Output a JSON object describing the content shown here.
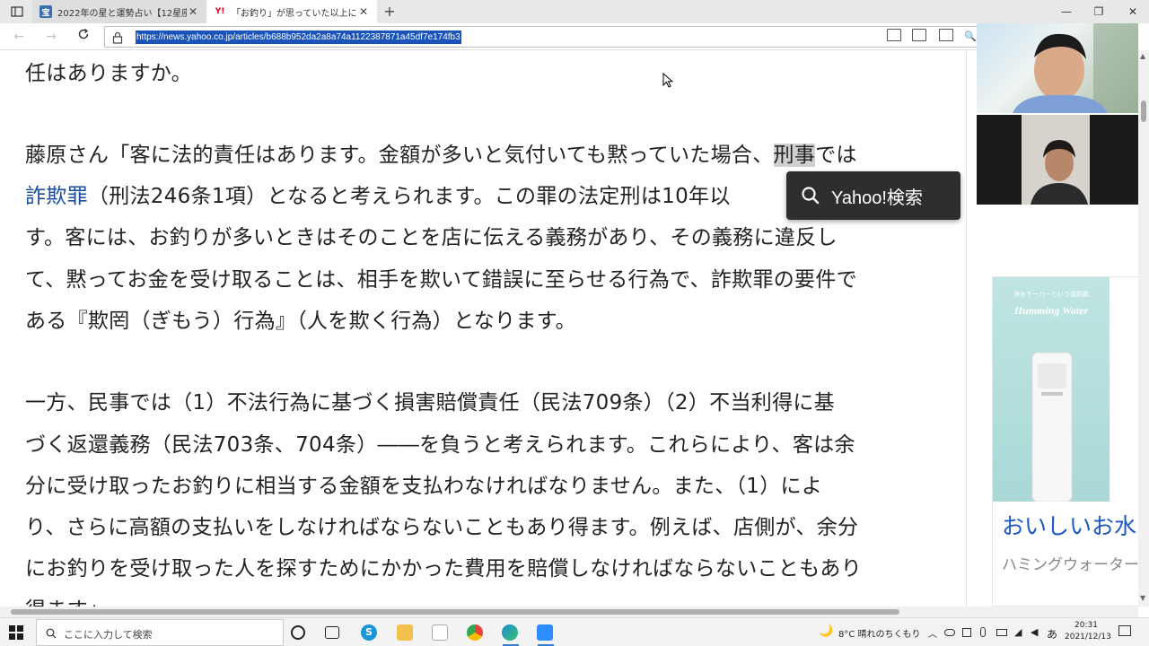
{
  "browser": {
    "tabs": [
      {
        "title": "2022年の星と運勢占い【12星座別",
        "favicon_label": "宝"
      },
      {
        "title": "「お釣り」が思っていた以上に多い→黙",
        "favicon_label": "Y!"
      }
    ],
    "url": "https://news.yahoo.co.jp/articles/b688b952da2a8a74a1122387871a45df7e174fb3"
  },
  "article": {
    "lines": [
      {
        "segments": [
          {
            "text": "任はありますか。"
          }
        ]
      },
      {
        "segments": [
          {
            "text": "藤原さん「客に法的責任はあります。金額が多いと気付いても黙っていた場合、"
          },
          {
            "text": "刑事",
            "style": "hl"
          },
          {
            "text": "では"
          }
        ]
      },
      {
        "segments": [
          {
            "text": "詐欺罪",
            "style": "link"
          },
          {
            "text": "（刑法246条1項）となると考えられます。この罪の法定刑は10年以"
          }
        ]
      },
      {
        "segments": [
          {
            "text": "す。客には、お釣りが多いときはそのことを店に伝える義務があり、その義務に違反し"
          }
        ]
      },
      {
        "segments": [
          {
            "text": "て、黙ってお金を受け取ることは、相手を欺いて錯誤に至らせる行為で、詐欺罪の要件で"
          }
        ]
      },
      {
        "segments": [
          {
            "text": "ある『欺罔（ぎもう）行為』（人を欺く行為）となります。"
          }
        ]
      },
      {
        "segments": [
          {
            "text": "一方、民事では（1）不法行為に基づく損害賠償責任（民法709条）（2）不当利得に基"
          }
        ]
      },
      {
        "segments": [
          {
            "text": "づく返還義務（民法703条、704条）――を負うと考えられます。これらにより、客は余"
          }
        ]
      },
      {
        "segments": [
          {
            "text": "分に受け取ったお釣りに相当する金額を支払わなければなりません。また、（1）によ"
          }
        ]
      },
      {
        "segments": [
          {
            "text": "り、さらに高額の支払いをしなければならないこともあり得ます。例えば、店側が、余分"
          }
        ]
      },
      {
        "segments": [
          {
            "text": "にお釣りを受け取った人を探すためにかかった費用を賠償しなければならないこともあり"
          }
        ]
      },
      {
        "segments": [
          {
            "text": "得ます」"
          }
        ]
      }
    ]
  },
  "popup": {
    "label": "Yahoo!検索"
  },
  "ad": {
    "small_text": "浄水サーバーという選択肢",
    "brand": "Humming Water",
    "title": "おいしいお水",
    "subtitle": "ハミングウォーター"
  },
  "taskbar": {
    "search_placeholder": "ここに入力して検索",
    "weather": "8°C  晴れのちくもり",
    "ime": "あ",
    "time": "20:31",
    "date": "2021/12/13"
  },
  "colors": {
    "link": "#1a4fa0",
    "url_selection": "#1a53b9",
    "ad_title": "#1b58c4",
    "popup_bg": "#2e2e2e"
  }
}
